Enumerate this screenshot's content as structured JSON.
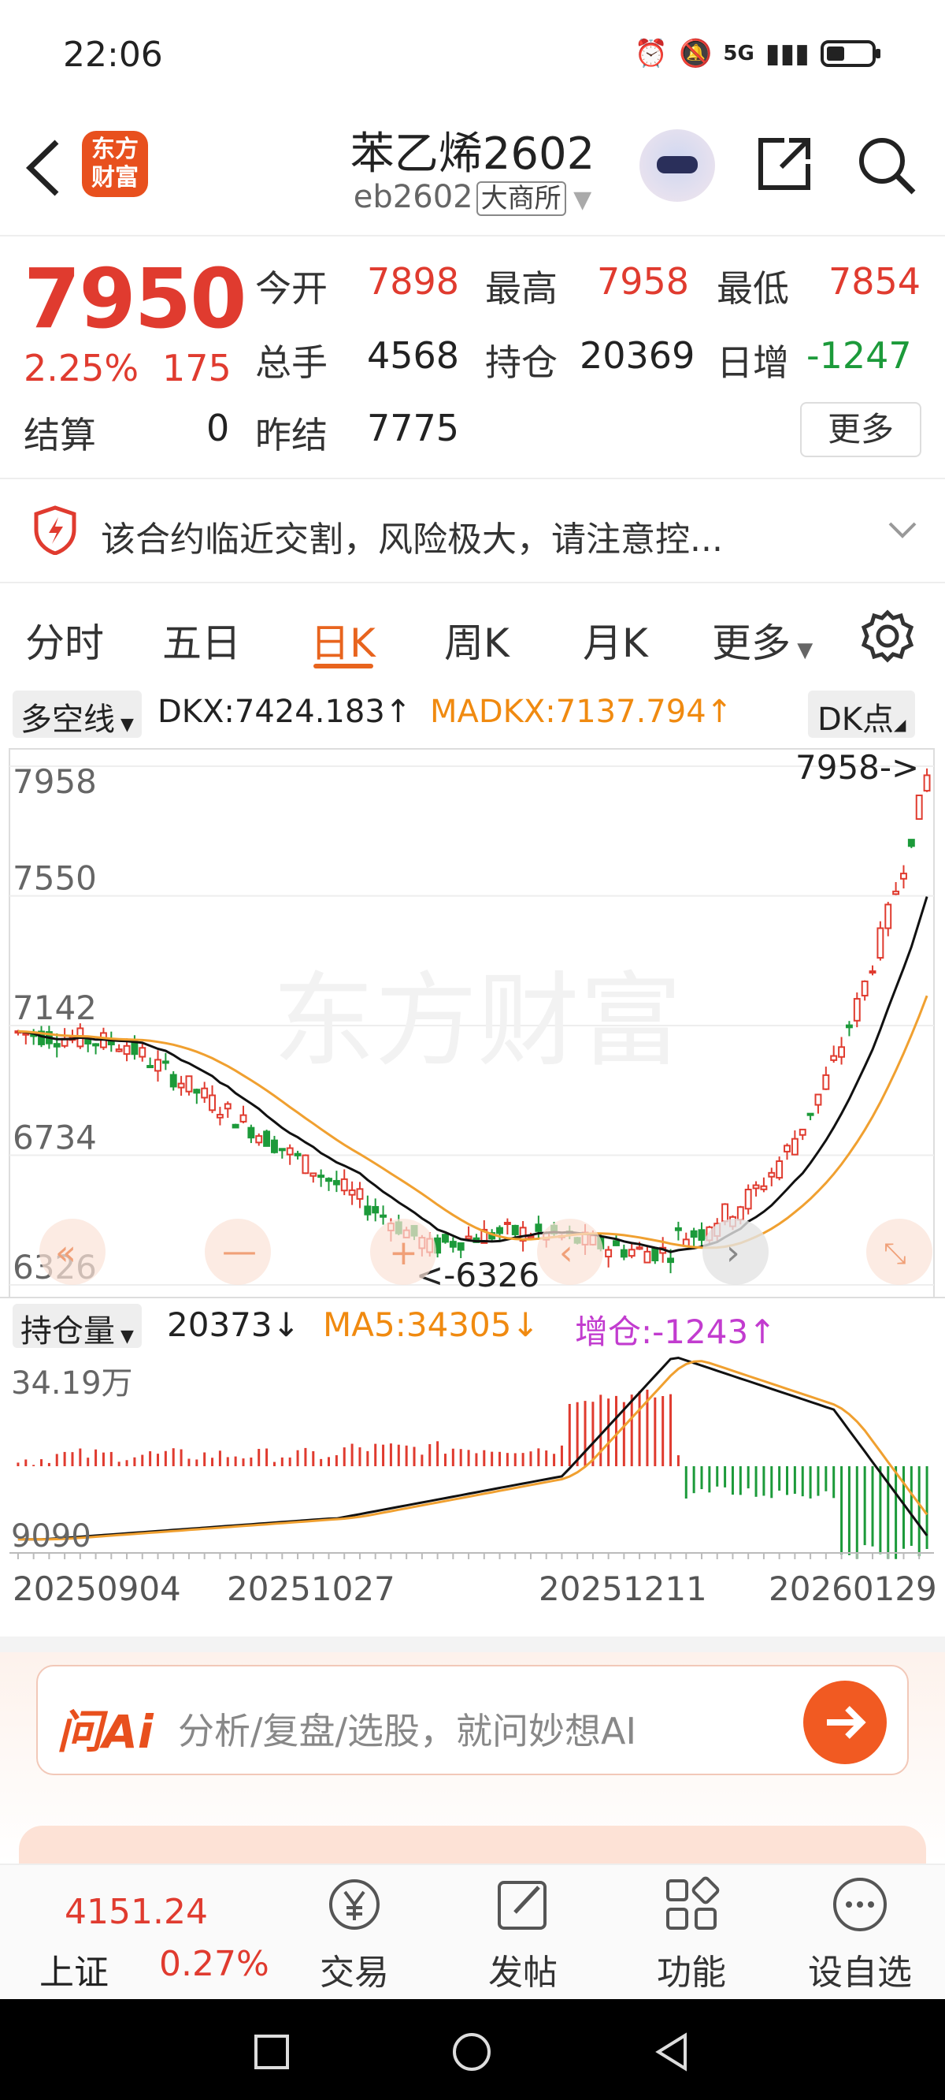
{
  "status": {
    "time": "22:06",
    "network": "5G"
  },
  "header": {
    "title": "苯乙烯2602",
    "code": "eb2602",
    "exchange": "大商所",
    "logo_text": "东方财富"
  },
  "quote": {
    "price": "7950",
    "change_pct": "2.25%",
    "change": "175",
    "open_label": "今开",
    "open": "7898",
    "high_label": "最高",
    "high": "7958",
    "low_label": "最低",
    "low": "7854",
    "volume_label": "总手",
    "volume": "4568",
    "oi_label": "持仓",
    "oi": "20369",
    "daily_inc_label": "日增",
    "daily_inc": "-1247",
    "settle_label": "结算",
    "settle": "0",
    "prev_settle_label": "昨结",
    "prev_settle": "7775",
    "more_label": "更多"
  },
  "risk": {
    "text": "该合约临近交割，风险极大，请注意控..."
  },
  "tabs": [
    "分时",
    "五日",
    "日K",
    "周K",
    "月K",
    "更多"
  ],
  "active_tab": "日K",
  "indicator": {
    "select": "多空线",
    "dkx": "DKX:7424.183↑",
    "madkx": "MADKX:7137.794↑",
    "dk_btn": "DK点"
  },
  "watermark": "东方财富",
  "sub_indicator": {
    "select": "持仓量",
    "value": "20373↓",
    "ma5": "MA5:34305↓",
    "inc": "增仓:-1243↑"
  },
  "chart_data": {
    "type": "candlestick",
    "y_ticks": [
      "7958",
      "7550",
      "7142",
      "6734",
      "6326"
    ],
    "ylim": [
      6326,
      7958
    ],
    "high_marker": "7958->",
    "low_marker": "<-6326",
    "sub_y_ticks": [
      "34.19万",
      "9090"
    ],
    "x_ticks": [
      "20250904",
      "20251027",
      "20251211",
      "20260129"
    ]
  },
  "ai": {
    "placeholder": "分析/复盘/选股，就问妙想AI",
    "logo": "问Ai"
  },
  "bottom_nav": {
    "index_value": "4151.24",
    "index_name": "上证",
    "index_pct": "0.27%",
    "items": [
      "交易",
      "发帖",
      "功能",
      "设自选"
    ]
  },
  "colors": {
    "up": "#e03b2f",
    "down": "#1c9a3a",
    "accent": "#e8641e",
    "ma": "#f0a030"
  }
}
